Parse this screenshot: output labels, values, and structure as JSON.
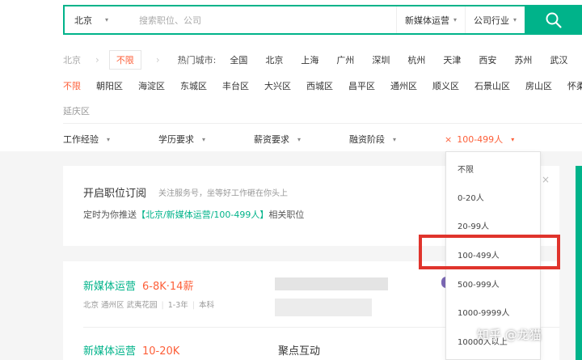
{
  "search": {
    "city": "北京",
    "placeholder": "搜索职位、公司",
    "category": "新媒体运营",
    "industry": "公司行业"
  },
  "location": {
    "current": "北京",
    "selected": "不限",
    "hot_label": "热门城市:",
    "hot_cities": [
      "全国",
      "北京",
      "上海",
      "广州",
      "深圳",
      "杭州",
      "天津",
      "西安",
      "苏州",
      "武汉"
    ]
  },
  "districts": [
    "不限",
    "朝阳区",
    "海淀区",
    "东城区",
    "丰台区",
    "大兴区",
    "西城区",
    "昌平区",
    "通州区",
    "顺义区",
    "石景山区",
    "房山区",
    "怀柔"
  ],
  "districts_row2": [
    "延庆区"
  ],
  "filters": {
    "experience": "工作经验",
    "education": "学历要求",
    "salary": "薪资要求",
    "funding": "融资阶段",
    "size_active": "100-499人",
    "size_clear": "×"
  },
  "subscribe": {
    "title": "开启职位订阅",
    "hint": "关注服务号，坐等好工作砸在你头上",
    "line_prefix": "定时为你推送",
    "line_highlight": "【北京/新媒体运营/100-499人】",
    "line_suffix": "相关职位",
    "close": "×"
  },
  "jobs": [
    {
      "title": "新媒体运营",
      "salary": "6-8K·14薪",
      "location": "北京 通州区 武夷花园",
      "experience": "1-3年",
      "education": "本科"
    },
    {
      "title": "新媒体运营",
      "salary": "10-20K",
      "company": "聚点互动"
    }
  ],
  "size_options": [
    "不限",
    "0-20人",
    "20-99人",
    "100-499人",
    "500-999人",
    "1000-9999人",
    "10000人以上"
  ],
  "watermark": "知乎 @龙猫",
  "colors": {
    "brand": "#00b38a",
    "accent": "#fd5f39",
    "highlight_box": "#e0342c"
  }
}
